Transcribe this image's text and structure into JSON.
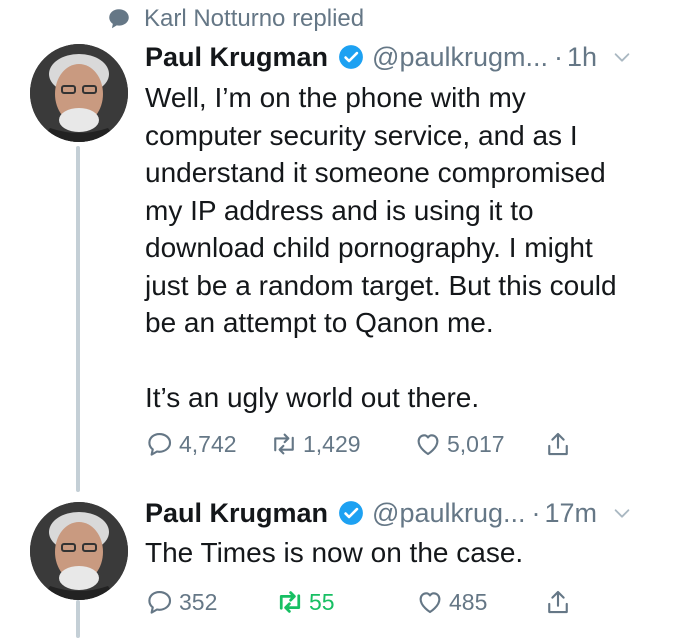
{
  "social_context": {
    "text": "Karl Notturno replied",
    "icon": "speech-bubble-icon"
  },
  "tweets": [
    {
      "name": "Paul Krugman",
      "handle": "@paulkrugm...",
      "time": "1h",
      "dot": "·",
      "body": "Well, I’m on the phone with my\ncomputer security service, and as I\nunderstand it someone compromised\nmy IP address and is using it to\ndownload child pornography. I might\njust be a random target. But this could\nbe an attempt to Qanon me.\n\nIt’s an ugly world out there.",
      "replies": "4,742",
      "retweets": "1,429",
      "likes": "5,017"
    },
    {
      "name": "Paul Krugman",
      "handle": "@paulkrug...",
      "time": "17m",
      "dot": "·",
      "body": "The Times is now on the case.",
      "replies": "352",
      "retweets": "55",
      "likes": "485"
    }
  ],
  "colors": {
    "text": "#14171a",
    "secondary": "#657786",
    "verified": "#1da1f2",
    "retweet_active": "#17bf63",
    "thread_line": "#c4cfd6"
  }
}
